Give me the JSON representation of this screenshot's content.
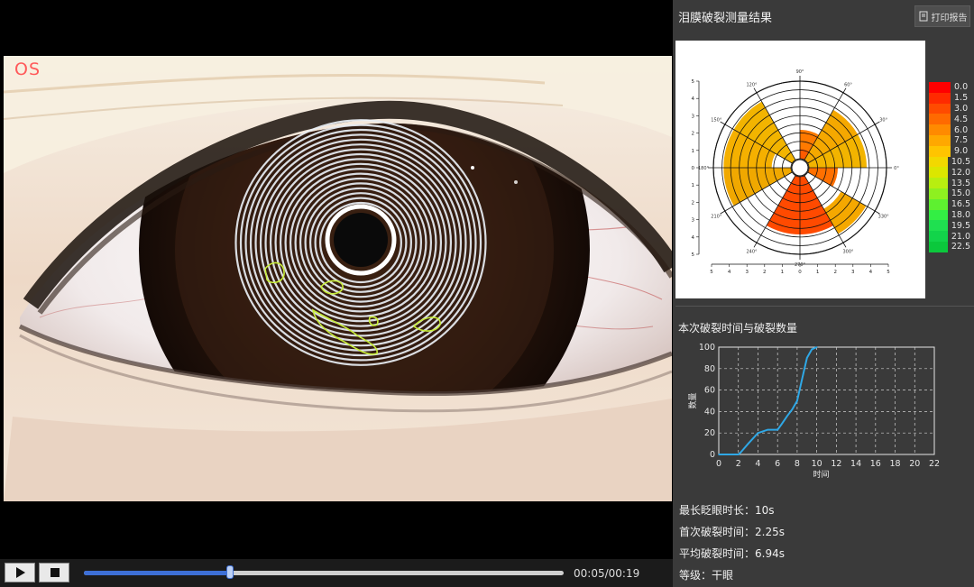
{
  "video": {
    "eye_label": "OS",
    "time": "00:05/00:19",
    "progress": 0.27
  },
  "right": {
    "title": "泪膜破裂测量结果",
    "print_label": "打印报告"
  },
  "polar_chart": {
    "angle_labels": [
      "0°",
      "30°",
      "60°",
      "90°",
      "120°",
      "150°",
      "180°",
      "210°",
      "240°",
      "270°",
      "300°",
      "330°"
    ],
    "radial_ticks": [
      5,
      4,
      3,
      2,
      1,
      0,
      1,
      2,
      3,
      4,
      5
    ],
    "legend": [
      {
        "value": "0.0",
        "color": "#ff0000"
      },
      {
        "value": "1.5",
        "color": "#ff2a00"
      },
      {
        "value": "3.0",
        "color": "#ff4b00"
      },
      {
        "value": "4.5",
        "color": "#ff6a00"
      },
      {
        "value": "6.0",
        "color": "#ff8a00"
      },
      {
        "value": "7.5",
        "color": "#ffa800"
      },
      {
        "value": "9.0",
        "color": "#ffc400"
      },
      {
        "value": "10.5",
        "color": "#f2d800"
      },
      {
        "value": "12.0",
        "color": "#dce600"
      },
      {
        "value": "13.5",
        "color": "#b8ee10"
      },
      {
        "value": "15.0",
        "color": "#8ef020"
      },
      {
        "value": "16.5",
        "color": "#5ef030"
      },
      {
        "value": "18.0",
        "color": "#33ee44"
      },
      {
        "value": "19.5",
        "color": "#1fe050"
      },
      {
        "value": "21.0",
        "color": "#12d44a"
      },
      {
        "value": "22.5",
        "color": "#0bc83c"
      }
    ],
    "sectors": [
      {
        "start": 0,
        "end": 30,
        "rings": [
          1,
          6
        ],
        "color": "#f2b400"
      },
      {
        "start": 30,
        "end": 60,
        "rings": [
          1,
          6
        ],
        "color": "#f5a800"
      },
      {
        "start": 60,
        "end": 90,
        "rings": [
          1,
          2
        ],
        "color": "#ff5a00"
      },
      {
        "start": 60,
        "end": 90,
        "rings": [
          2,
          3
        ],
        "color": "#ff7a00"
      },
      {
        "start": 120,
        "end": 150,
        "rings": [
          1,
          7
        ],
        "color": "#f2b400"
      },
      {
        "start": 150,
        "end": 180,
        "rings": [
          3,
          7
        ],
        "color": "#f5b000"
      },
      {
        "start": 180,
        "end": 210,
        "rings": [
          1,
          7
        ],
        "color": "#f0a800"
      },
      {
        "start": 240,
        "end": 300,
        "rings": [
          1,
          6
        ],
        "color": "#ff4a00"
      },
      {
        "start": 300,
        "end": 330,
        "rings": [
          5,
          7
        ],
        "color": "#f5a800"
      },
      {
        "start": 330,
        "end": 360,
        "rings": [
          1,
          3
        ],
        "color": "#ff7000"
      }
    ]
  },
  "line_chart": {
    "title": "本次破裂时间与破裂数量",
    "type": "line",
    "xlabel": "时间",
    "ylabel": "数量",
    "xlim": [
      0,
      22
    ],
    "ylim": [
      0,
      100
    ],
    "xticks": [
      0,
      2,
      4,
      6,
      8,
      10,
      12,
      14,
      16,
      18,
      20,
      22
    ],
    "yticks": [
      0,
      20,
      40,
      60,
      80,
      100
    ],
    "grid": true,
    "x": [
      0,
      2,
      2.25,
      3,
      4,
      5,
      6,
      6.4,
      7,
      7.5,
      8,
      8.5,
      9,
      9.5,
      10
    ],
    "y": [
      0,
      0,
      2,
      10,
      20,
      23,
      23,
      28,
      36,
      42,
      50,
      70,
      90,
      98,
      100
    ]
  },
  "stats": [
    "最长眨眼时长：10s",
    "首次破裂时间：2.25s",
    "平均破裂时间：6.94s",
    "等级：干眼"
  ],
  "colors": {
    "accent": "#3d6fd6",
    "line": "#2fa8e6",
    "annotation": "#c8ee3a"
  }
}
